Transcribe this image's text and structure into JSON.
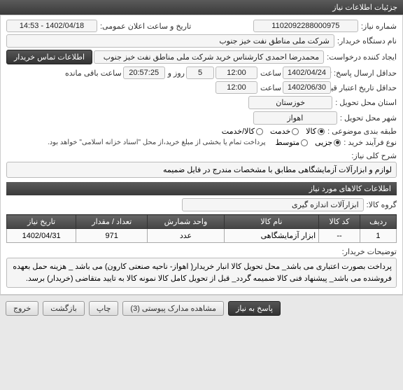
{
  "header": {
    "title": "جزئیات اطلاعات نیاز"
  },
  "fields": {
    "need_no_label": "شماره نیاز:",
    "need_no": "1102092288000975",
    "ann_date_label": "تاریخ و ساعت اعلان عمومی:",
    "ann_date": "1402/04/18 - 14:53",
    "buyer_label": "نام دستگاه خریدار:",
    "buyer": "شرکت ملی مناطق نفت خیز جنوب",
    "creator_label": "ایجاد کننده درخواست:",
    "creator": "محمدرضا احمدی  کارشناس خرید  شرکت ملی مناطق نفت خیز جنوب",
    "contact_btn": "اطلاعات تماس خریدار",
    "resp_deadline_label": "حداقل ارسال پاسخ: تا تاریخ:",
    "resp_date": "1402/04/24",
    "time_label": "ساعت",
    "resp_time": "12:00",
    "days": "5",
    "day_and": "روز و",
    "remain_time": "20:57:25",
    "remain_label": "ساعت باقی مانده",
    "valid_label": "حداقل تاریخ اعتبار قیمت: تا تاریخ:",
    "valid_date": "1402/06/30",
    "valid_time": "12:00",
    "province_label": "استان محل تحویل :",
    "province": "خوزستان",
    "city_label": "شهر محل تحویل :",
    "city": "اهواز",
    "cat_label": "طبقه بندی موضوعی :",
    "cat_goods": "کالا",
    "cat_service": "خدمت",
    "cat_goods_service": "کالا/خدمت",
    "proc_label": "نوع فرآیند خرید :",
    "proc_low": "جزیی",
    "proc_mid": "متوسط",
    "proc_note": "پرداخت تمام یا بخشی از مبلغ خرید،از محل \"اسناد خزانه اسلامی\" خواهد بود.",
    "desc_label": "شرح کلی نیاز:",
    "desc": "لوازم و ابزارآلات آزمایشگاهی مطابق با مشخصات مندرج در فایل ضمیمه"
  },
  "items_section": {
    "title": "اطلاعات کالاهای مورد نیاز",
    "group_label": "گروه کالا:",
    "group": "ابزارآلات اندازه گیری"
  },
  "table": {
    "headers": [
      "ردیف",
      "کد کالا",
      "نام کالا",
      "واحد شمارش",
      "تعداد / مقدار",
      "تاریخ نیاز"
    ],
    "rows": [
      {
        "idx": "1",
        "code": "--",
        "name": "ابزار آزمایشگاهی",
        "unit": "عدد",
        "qty": "971",
        "date": "1402/04/31"
      }
    ]
  },
  "buyer_notes": {
    "label": "توضیحات خریدار:",
    "text": "پرداخت بصورت اعتباری می باشد_ محل تحویل کالا انبار خریدار( اهواز- ناحیه صنعتی کارون) می باشد _ هزینه حمل بعهده فروشنده می باشد_  پیشنهاد فنی کالا ضمیمه گردد_ قبل از تحویل کامل کالا  نمونه کالا به تایید متقاضی (خریدار) برسد."
  },
  "footer": {
    "respond": "پاسخ به نیاز",
    "attach": "مشاهده مدارک پیوستی (3)",
    "print": "چاپ",
    "back": "بازگشت",
    "exit": "خروج"
  }
}
